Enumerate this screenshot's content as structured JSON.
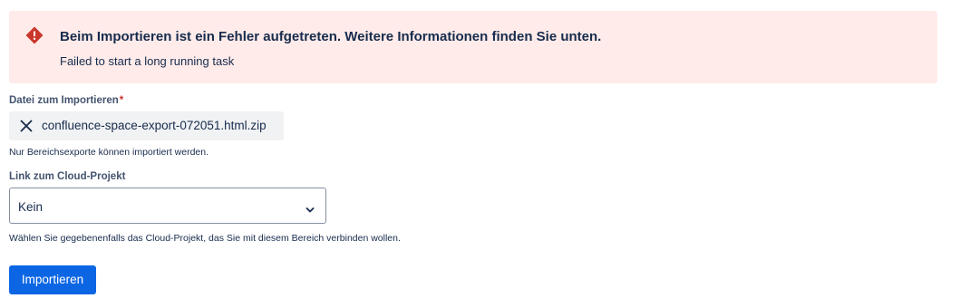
{
  "error_banner": {
    "icon": "error-icon",
    "title": "Beim Importieren ist ein Fehler aufgetreten. Weitere Informationen finden Sie unten.",
    "description": "Failed to start a long running task",
    "background_color": "#ffebe9",
    "icon_color": "#c9372c"
  },
  "file_field": {
    "label": "Datei zum Importieren",
    "required_marker": "*",
    "file_name": "confluence-space-export-072051.html.zip",
    "remove_icon": "close-icon",
    "helper_text": "Nur Bereichsexporte können importiert werden."
  },
  "cloud_project_field": {
    "label": "Link zum Cloud-Projekt",
    "selected_value": "Kein",
    "dropdown_icon": "chevron-down-icon",
    "helper_text": "Wählen Sie gegebenenfalls das Cloud-Projekt, das Sie mit diesem Bereich verbinden wollen."
  },
  "submit_button": {
    "label": "Importieren",
    "color": "#0c66e4"
  }
}
